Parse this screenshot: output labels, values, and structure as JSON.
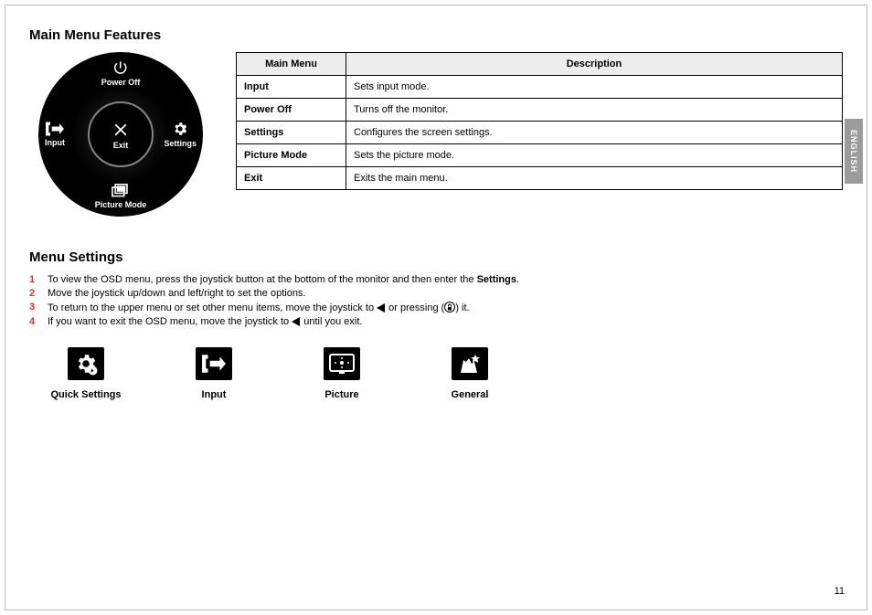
{
  "lang_tab": "ENGLISH",
  "page_number": "11",
  "section1": {
    "title": "Main Menu Features",
    "joystick": {
      "top": {
        "label": "Power Off"
      },
      "left": {
        "label": "Input"
      },
      "right": {
        "label": "Settings"
      },
      "bottom": {
        "label": "Picture Mode"
      },
      "center": {
        "label": "Exit"
      }
    },
    "table": {
      "head": {
        "c1": "Main Menu",
        "c2": "Description"
      },
      "rows": [
        {
          "c1": "Input",
          "c2": "Sets input mode."
        },
        {
          "c1": "Power Off",
          "c2": "Turns off the monitor."
        },
        {
          "c1": "Settings",
          "c2": "Configures the screen settings."
        },
        {
          "c1": "Picture Mode",
          "c2": "Sets the picture mode."
        },
        {
          "c1": "Exit",
          "c2": "Exits the main menu."
        }
      ]
    }
  },
  "section2": {
    "title": "Menu Settings",
    "steps": {
      "s1a": "To view the OSD menu, press the joystick button at the bottom of the monitor and then enter the ",
      "s1b": "Settings",
      "s1c": ".",
      "s2": "Move the joystick up/down and left/right to set the options.",
      "s3a": "To return to the upper menu or set other menu items, move the joystick to ",
      "s3b": " or pressing (",
      "s3c": ") it.",
      "s4a": "If you want to exit the OSD menu, move the joystick to ",
      "s4b": " until you exit."
    },
    "icons": {
      "i1": "Quick Settings",
      "i2": "Input",
      "i3": "Picture",
      "i4": "General"
    }
  }
}
